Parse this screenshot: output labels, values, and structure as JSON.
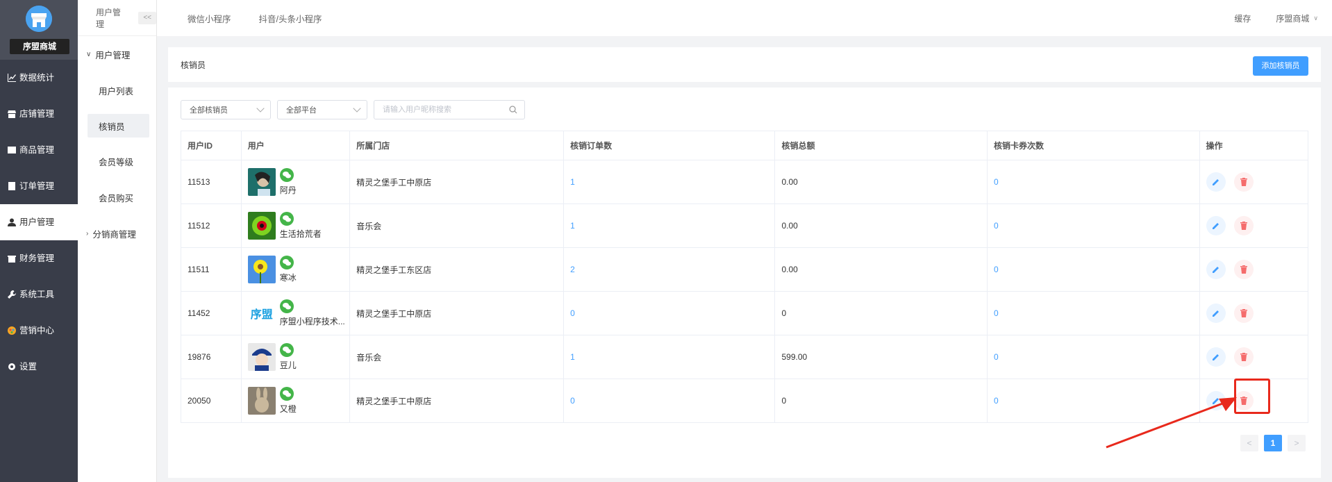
{
  "sidebar": {
    "shop_name": "序盟商城",
    "items": [
      {
        "label": "数据统计",
        "icon": "chart-icon"
      },
      {
        "label": "店铺管理",
        "icon": "store-icon"
      },
      {
        "label": "商品管理",
        "icon": "goods-icon"
      },
      {
        "label": "订单管理",
        "icon": "order-icon"
      },
      {
        "label": "用户管理",
        "icon": "user-icon",
        "active": true
      },
      {
        "label": "财务管理",
        "icon": "finance-icon"
      },
      {
        "label": "系统工具",
        "icon": "wrench-icon"
      },
      {
        "label": "营销中心",
        "icon": "marketing-icon"
      },
      {
        "label": "设置",
        "icon": "settings-icon"
      }
    ]
  },
  "subnav": {
    "title": "用户管理",
    "collapse": "<<",
    "group": "用户管理",
    "items": [
      "用户列表",
      "核销员",
      "会员等级",
      "会员购买"
    ],
    "active": "核销员",
    "group2": "分销商管理"
  },
  "topbar": {
    "tabs": [
      "微信小程序",
      "抖音/头条小程序"
    ],
    "cache": "缓存",
    "user": "序盟商城"
  },
  "header": {
    "title": "核销员",
    "add_button": "添加核销员"
  },
  "filters": {
    "verifier": "全部核销员",
    "platform": "全部平台",
    "search_placeholder": "请输入用户昵称搜索"
  },
  "table": {
    "headers": [
      "用户ID",
      "用户",
      "所属门店",
      "核销订单数",
      "核销总额",
      "核销卡券次数",
      "操作"
    ],
    "rows": [
      {
        "id": "11513",
        "name": "阿丹",
        "store": "精灵之堡手工中原店",
        "orders": "1",
        "total": "0.00",
        "coupons": "0"
      },
      {
        "id": "11512",
        "name": "生活拾荒者",
        "store": "音乐会",
        "orders": "1",
        "total": "0.00",
        "coupons": "0"
      },
      {
        "id": "11511",
        "name": "寒冰",
        "store": "精灵之堡手工东区店",
        "orders": "2",
        "total": "0.00",
        "coupons": "0"
      },
      {
        "id": "11452",
        "name": "序盟小程序技术...",
        "store": "精灵之堡手工中原店",
        "orders": "0",
        "total": "0",
        "coupons": "0",
        "logo_text": "序盟"
      },
      {
        "id": "19876",
        "name": "豆儿",
        "store": "音乐会",
        "orders": "1",
        "total": "599.00",
        "coupons": "0"
      },
      {
        "id": "20050",
        "name": "又橙",
        "store": "精灵之堡手工中原店",
        "orders": "0",
        "total": "0",
        "coupons": "0"
      }
    ]
  },
  "pagination": {
    "prev": "<",
    "current": "1",
    "next": ">"
  },
  "colors": {
    "primary": "#409eff",
    "sidebar": "#393d49",
    "danger": "#f56c6c",
    "wechat": "#44b549",
    "annotation": "#e8291c"
  }
}
